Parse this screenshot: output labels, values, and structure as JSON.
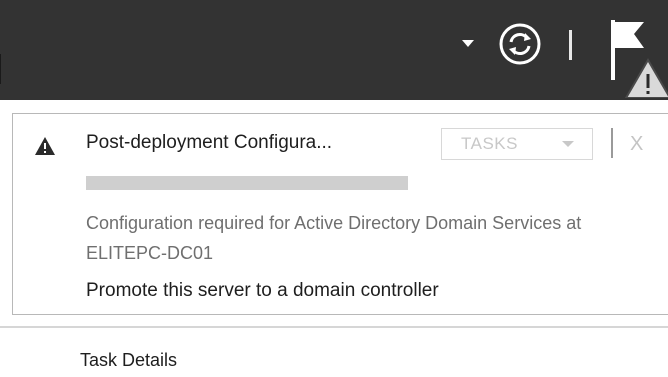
{
  "header": {
    "menu_arrow_icon": "chevron-down-icon",
    "refresh_icon": "refresh-icon",
    "notifications_icon": "flag-warning-icon"
  },
  "notification": {
    "status_icon": "warning-icon",
    "title": "Post-deployment Configura...",
    "tasks_label": "TASKS",
    "close_label": "X",
    "progress": 1.0,
    "description": "Configuration required for Active Directory Domain Services at ELITEPC-DC01",
    "action_link": "Promote this server to a domain controller"
  },
  "footer": {
    "task_details_label": "Task Details"
  },
  "colors": {
    "header_bg": "#333333",
    "warning_badge": "#d9d9d9"
  }
}
